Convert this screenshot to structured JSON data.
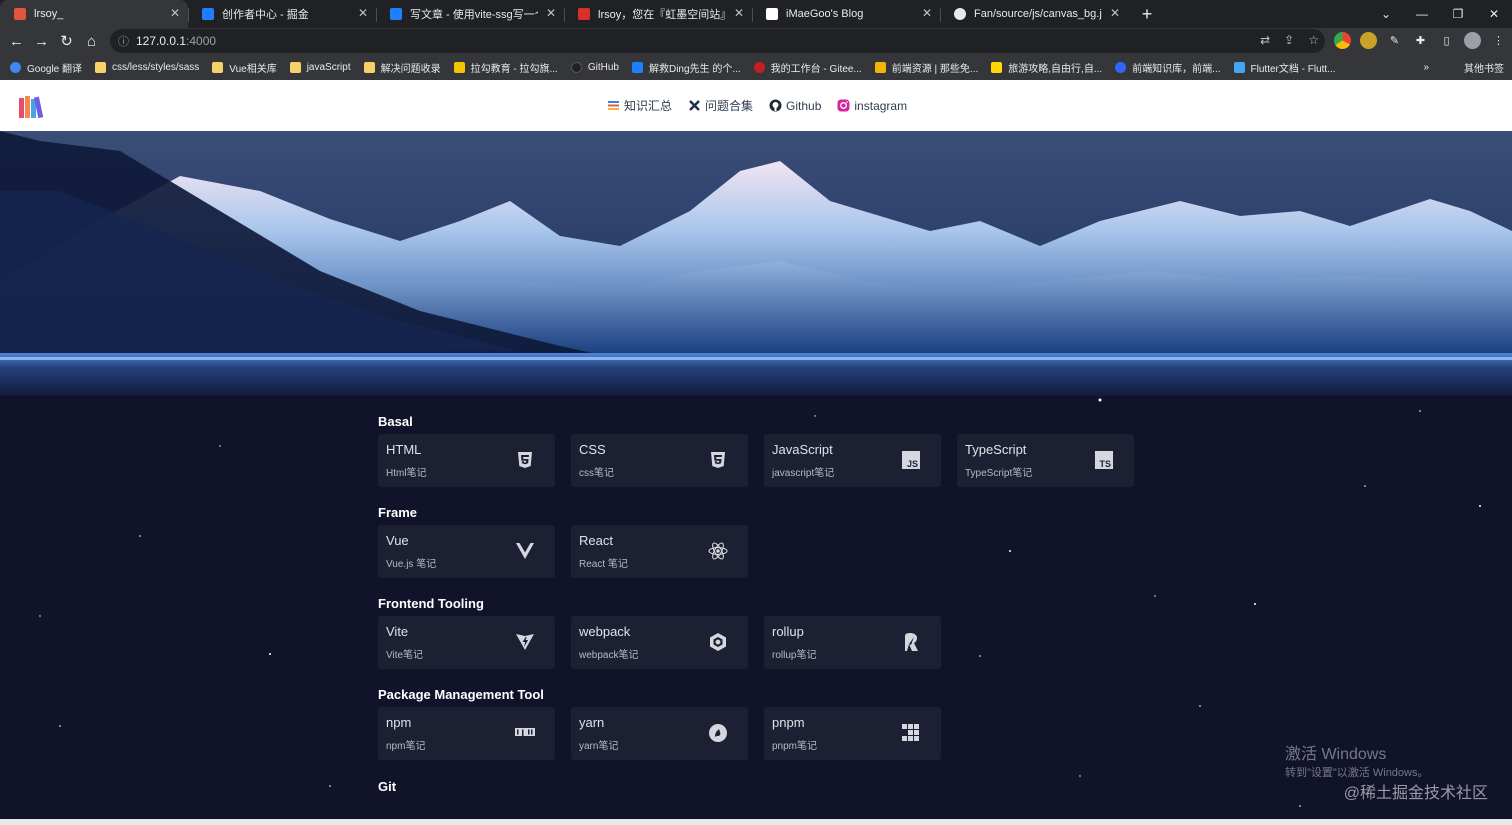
{
  "browser": {
    "tabs": [
      {
        "title": "lrsoy_",
        "active": true,
        "favicon_color": "#e0553c"
      },
      {
        "title": "创作者中心 - 掘金",
        "favicon_color": "#1e80ff"
      },
      {
        "title": "写文章 - 使用vite-ssg写一个存放",
        "favicon_color": "#1e80ff"
      },
      {
        "title": "lrsoy，您在『虹墨空间站』上的",
        "favicon_color": "#d93025"
      },
      {
        "title": "iMaeGoo's Blog",
        "favicon_color": "#ffffff"
      },
      {
        "title": "Fan/source/js/canvas_bg.js at",
        "favicon_color": "#e8eaed"
      }
    ],
    "new_tab": "+",
    "url": "127.0.0.1",
    "port": ":4000",
    "bookmarks": [
      {
        "label": "Google 翻译",
        "color": "#4285f4"
      },
      {
        "label": "css/less/styles/sass",
        "color": "#f6d168"
      },
      {
        "label": "Vue相关库",
        "color": "#f6d168"
      },
      {
        "label": "javaScript",
        "color": "#f6d168"
      },
      {
        "label": "解决问题收录",
        "color": "#f6d168"
      },
      {
        "label": "拉勾教育 - 拉勾旗...",
        "color": "#f5c400"
      },
      {
        "label": "GitHub",
        "color": "#202124"
      },
      {
        "label": "解救Ding先生 的个...",
        "color": "#1e80ff"
      },
      {
        "label": "我的工作台 - Gitee...",
        "color": "#c71d23"
      },
      {
        "label": "前端资源 | 那些免...",
        "color": "#f4b400"
      },
      {
        "label": "旅游攻略,自由行,自...",
        "color": "#ffd900"
      },
      {
        "label": "前端知识库，前端...",
        "color": "#3366ff"
      },
      {
        "label": "Flutter文档 - Flutt...",
        "color": "#42a5f5"
      }
    ],
    "bookmarks_more": "»",
    "other_bookmarks": "其他书签"
  },
  "site": {
    "nav": [
      {
        "label": "知识汇总",
        "icon": "book-stack-icon"
      },
      {
        "label": "问题合集",
        "icon": "cross-tools-icon"
      },
      {
        "label": "Github",
        "icon": "github-icon"
      },
      {
        "label": "instagram",
        "icon": "instagram-icon"
      }
    ]
  },
  "sections": [
    {
      "title": "Basal",
      "cards": [
        {
          "name": "HTML",
          "desc": "Html笔记",
          "icon": "html5-icon"
        },
        {
          "name": "CSS",
          "desc": "css笔记",
          "icon": "css3-icon"
        },
        {
          "name": "JavaScript",
          "desc": "javascript笔记",
          "icon": "js-icon"
        },
        {
          "name": "TypeScript",
          "desc": "TypeScript笔记",
          "icon": "ts-icon"
        }
      ]
    },
    {
      "title": "Frame",
      "cards": [
        {
          "name": "Vue",
          "desc": "Vue.js 笔记",
          "icon": "vue-icon"
        },
        {
          "name": "React",
          "desc": "React 笔记",
          "icon": "react-icon"
        }
      ]
    },
    {
      "title": "Frontend Tooling",
      "cards": [
        {
          "name": "Vite",
          "desc": "Vite笔记",
          "icon": "vite-icon"
        },
        {
          "name": "webpack",
          "desc": "webpack笔记",
          "icon": "webpack-icon"
        },
        {
          "name": "rollup",
          "desc": "rollup笔记",
          "icon": "rollup-icon"
        }
      ]
    },
    {
      "title": "Package Management Tool",
      "cards": [
        {
          "name": "npm",
          "desc": "npm笔记",
          "icon": "npm-icon"
        },
        {
          "name": "yarn",
          "desc": "yarn笔记",
          "icon": "yarn-icon"
        },
        {
          "name": "pnpm",
          "desc": "pnpm笔记",
          "icon": "pnpm-icon"
        }
      ]
    },
    {
      "title": "Git",
      "cards": []
    }
  ],
  "watermarks": {
    "activate_title": "激活 Windows",
    "activate_sub": "转到\"设置\"以激活 Windows。",
    "community": "@稀土掘金技术社区"
  }
}
